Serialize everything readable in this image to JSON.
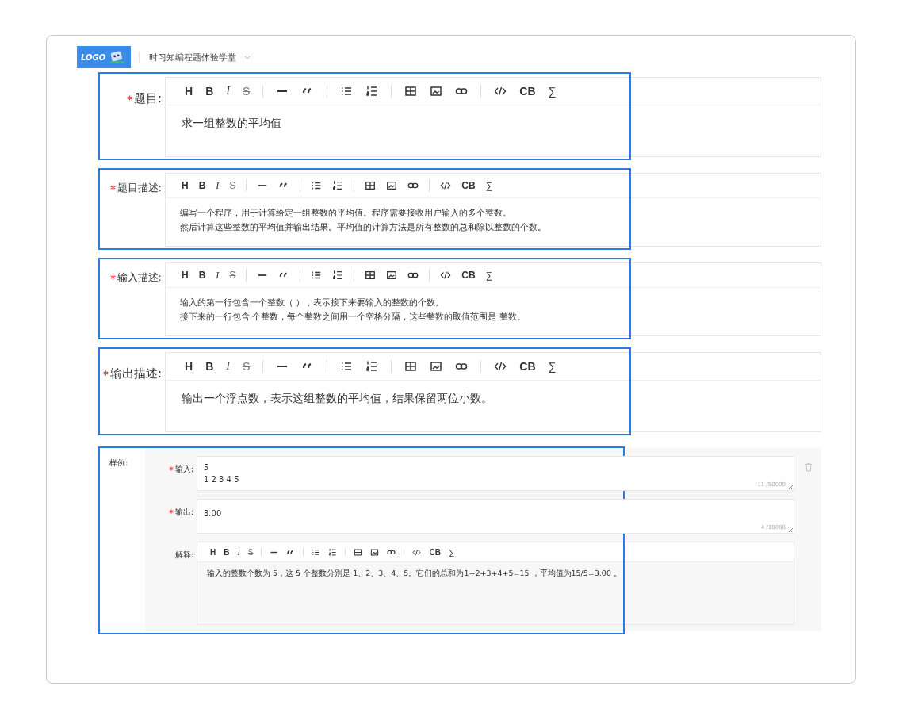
{
  "header": {
    "logo": "LOGO",
    "app_title": "时习知编程题体验学堂"
  },
  "sections": [
    {
      "label": "题目:",
      "required": true,
      "kind": "title",
      "highlighted": true,
      "toolbar": [
        {
          "kind": "heading",
          "label": "H"
        },
        {
          "kind": "bold",
          "label": "B"
        },
        {
          "kind": "italic",
          "label": "I"
        },
        {
          "kind": "strike",
          "label": "S"
        },
        {
          "kind": "sep"
        },
        {
          "kind": "hr"
        },
        {
          "kind": "quote"
        },
        {
          "kind": "sep"
        },
        {
          "kind": "ul"
        },
        {
          "kind": "ol"
        },
        {
          "kind": "sep"
        },
        {
          "kind": "table"
        },
        {
          "kind": "image"
        },
        {
          "kind": "link"
        },
        {
          "kind": "sep"
        },
        {
          "kind": "code"
        },
        {
          "kind": "codeblock",
          "label": "CB"
        },
        {
          "kind": "formula",
          "label": "∑"
        }
      ],
      "lines": [
        "求一组整数的平均值"
      ]
    },
    {
      "label": "题目描述:",
      "required": true,
      "kind": "text",
      "highlighted": true,
      "toolbar": [
        {
          "kind": "heading",
          "label": "H"
        },
        {
          "kind": "bold",
          "label": "B"
        },
        {
          "kind": "italic",
          "label": "I"
        },
        {
          "kind": "strike",
          "label": "S"
        },
        {
          "kind": "sep"
        },
        {
          "kind": "hr"
        },
        {
          "kind": "quote"
        },
        {
          "kind": "sep"
        },
        {
          "kind": "ul"
        },
        {
          "kind": "ol"
        },
        {
          "kind": "sep"
        },
        {
          "kind": "table"
        },
        {
          "kind": "image"
        },
        {
          "kind": "link"
        },
        {
          "kind": "sep"
        },
        {
          "kind": "code"
        },
        {
          "kind": "codeblock",
          "label": "CB"
        },
        {
          "kind": "formula",
          "label": "∑"
        }
      ],
      "lines": [
        "编写一个程序，用于计算给定一组整数的平均值。程序需要接收用户输入的多个整数。",
        "然后计算这些整数的平均值并输出结果。平均值的计算方法是所有整数的总和除以整数的个数。"
      ]
    },
    {
      "label": "输入描述:",
      "required": true,
      "kind": "text",
      "highlighted": true,
      "toolbar": [
        {
          "kind": "heading",
          "label": "H"
        },
        {
          "kind": "bold",
          "label": "B"
        },
        {
          "kind": "italic",
          "label": "I"
        },
        {
          "kind": "strike",
          "label": "S"
        },
        {
          "kind": "sep"
        },
        {
          "kind": "hr"
        },
        {
          "kind": "quote"
        },
        {
          "kind": "sep"
        },
        {
          "kind": "ul"
        },
        {
          "kind": "ol"
        },
        {
          "kind": "sep"
        },
        {
          "kind": "table"
        },
        {
          "kind": "image"
        },
        {
          "kind": "link"
        },
        {
          "kind": "sep"
        },
        {
          "kind": "code"
        },
        {
          "kind": "codeblock",
          "label": "CB"
        },
        {
          "kind": "formula",
          "label": "∑"
        }
      ],
      "lines": [
        "输入的第一行包含一个整数（ ），表示接下来要输入的整数的个数。",
        "接下来的一行包含  个整数，每个整数之间用一个空格分隔，这些整数的取值范围是  整数。"
      ]
    },
    {
      "label": "输出描述:",
      "required": true,
      "kind": "title",
      "highlighted": true,
      "toolbar": [
        {
          "kind": "heading",
          "label": "H"
        },
        {
          "kind": "bold",
          "label": "B"
        },
        {
          "kind": "italic",
          "label": "I"
        },
        {
          "kind": "strike",
          "label": "S"
        },
        {
          "kind": "sep"
        },
        {
          "kind": "hr"
        },
        {
          "kind": "quote"
        },
        {
          "kind": "sep"
        },
        {
          "kind": "ul"
        },
        {
          "kind": "ol"
        },
        {
          "kind": "sep"
        },
        {
          "kind": "table"
        },
        {
          "kind": "image"
        },
        {
          "kind": "link"
        },
        {
          "kind": "sep"
        },
        {
          "kind": "code"
        },
        {
          "kind": "codeblock",
          "label": "CB"
        },
        {
          "kind": "formula",
          "label": "∑"
        }
      ],
      "lines": [
        "输出一个浮点数，表示这组整数的平均值，结果保留两位小数。"
      ]
    }
  ],
  "sample": {
    "label": "样例:",
    "highlighted": true,
    "input": {
      "label": "输入:",
      "required": true,
      "value": "5\n1 2 3 4 5",
      "counter": "11 /50000"
    },
    "output": {
      "label": "输出:",
      "required": true,
      "value": "3.00",
      "counter": "4 /10000"
    },
    "explanation": {
      "label": "解释:",
      "required": false,
      "toolbar": [
        {
          "kind": "heading",
          "label": "H"
        },
        {
          "kind": "bold",
          "label": "B"
        },
        {
          "kind": "italic",
          "label": "I"
        },
        {
          "kind": "strike",
          "label": "S"
        },
        {
          "kind": "sep"
        },
        {
          "kind": "hr"
        },
        {
          "kind": "quote"
        },
        {
          "kind": "sep"
        },
        {
          "kind": "ul"
        },
        {
          "kind": "ol"
        },
        {
          "kind": "sep"
        },
        {
          "kind": "table"
        },
        {
          "kind": "image"
        },
        {
          "kind": "link"
        },
        {
          "kind": "sep"
        },
        {
          "kind": "code"
        },
        {
          "kind": "codeblock",
          "label": "CB"
        },
        {
          "kind": "formula",
          "label": "∑"
        }
      ],
      "lines": [
        "输入的整数个数为 5，这 5 个整数分别是 1、2、3、4、5。它们的总和为1+2+3+4+5=15 ，平均值为15/5=3.00 。"
      ]
    }
  }
}
